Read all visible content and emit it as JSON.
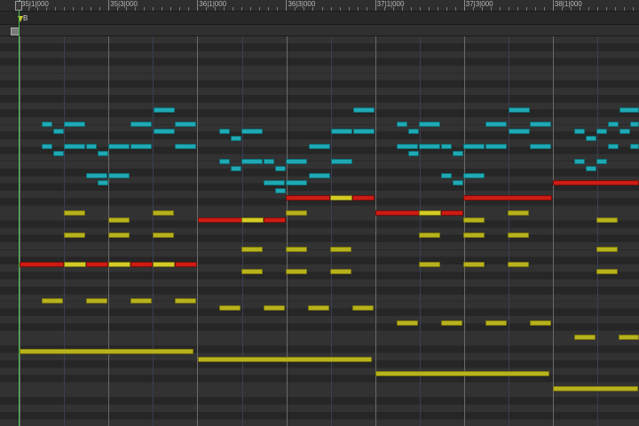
{
  "ruler": {
    "bars": [
      {
        "label": "35|1|000"
      },
      {
        "label": "35|3|000"
      },
      {
        "label": "36|1|000"
      },
      {
        "label": "36|3|000"
      },
      {
        "label": "37|1|000"
      },
      {
        "label": "37|3|000"
      },
      {
        "label": "38|1|000"
      }
    ]
  },
  "marker": {
    "label": "B"
  },
  "colors": {
    "cyan": "#1fa9b4",
    "yellow": "#b8b21c",
    "red": "#cc1c14",
    "playhead": "#4cc04c"
  }
}
